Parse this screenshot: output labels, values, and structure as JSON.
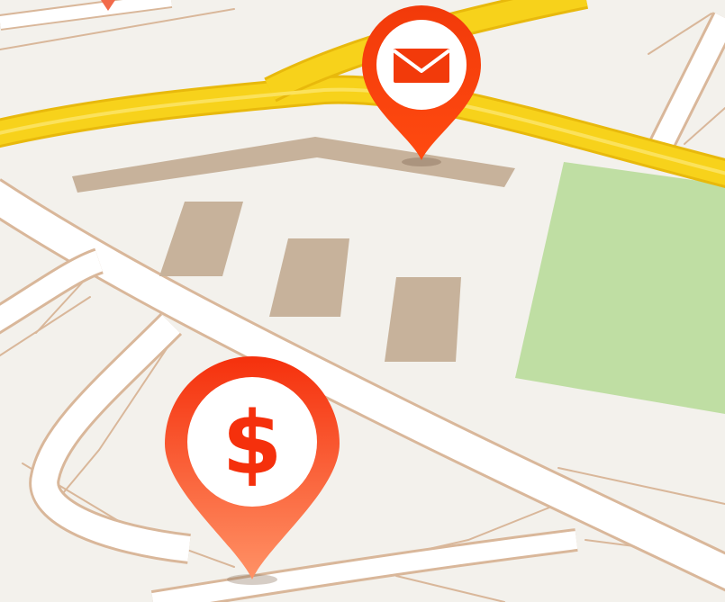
{
  "map": {
    "colors": {
      "background": "#F3F1EC",
      "road_fill": "#FFFFFF",
      "road_casing": "#D9B79A",
      "highway": "#F7D21B",
      "highway_edge": "#E8B90C",
      "building": "#C7B29B",
      "park": "#BFDEA3"
    }
  },
  "markers": [
    {
      "id": "mail",
      "icon": "mail-icon",
      "color_top": "#F23A0A",
      "color_bottom": "#F26A3A"
    },
    {
      "id": "money",
      "icon": "dollar-icon",
      "label": "$",
      "color_top": "#F5300C",
      "color_bottom": "#FF9266"
    }
  ]
}
